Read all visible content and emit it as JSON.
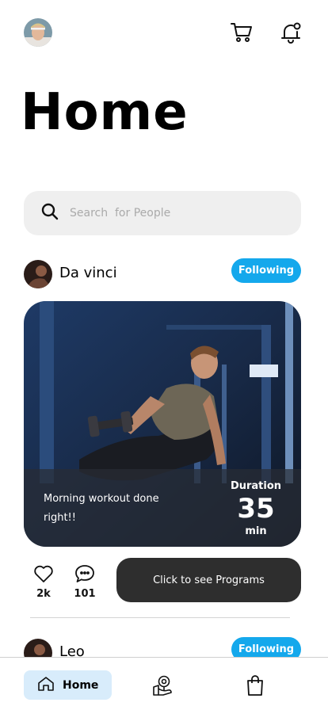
{
  "header": {
    "profile_icon": "user-avatar",
    "cart_icon": "cart-icon",
    "bell_icon": "bell-icon",
    "title": "Home"
  },
  "search": {
    "placeholder": "Search  for People",
    "value": "",
    "icon": "search-icon"
  },
  "posts": [
    {
      "author": "Da vinci",
      "follow_label": "Following",
      "caption": "Morning workout done right!!",
      "duration_label": "Duration",
      "duration_value": "35",
      "duration_unit": "min",
      "likes": "2k",
      "comments": "101",
      "programs_label": "Click to see Programs"
    },
    {
      "author": "Leo",
      "follow_label": "Following"
    }
  ],
  "nav": {
    "home_label": "Home",
    "home_icon": "home-icon",
    "map_icon": "location-icon",
    "bag_icon": "shopping-bag-icon"
  },
  "colors": {
    "accent": "#14a8ec",
    "dark_button": "#2e2e2e",
    "search_bg": "#efefef",
    "nav_active_bg": "#d8ecfb"
  }
}
